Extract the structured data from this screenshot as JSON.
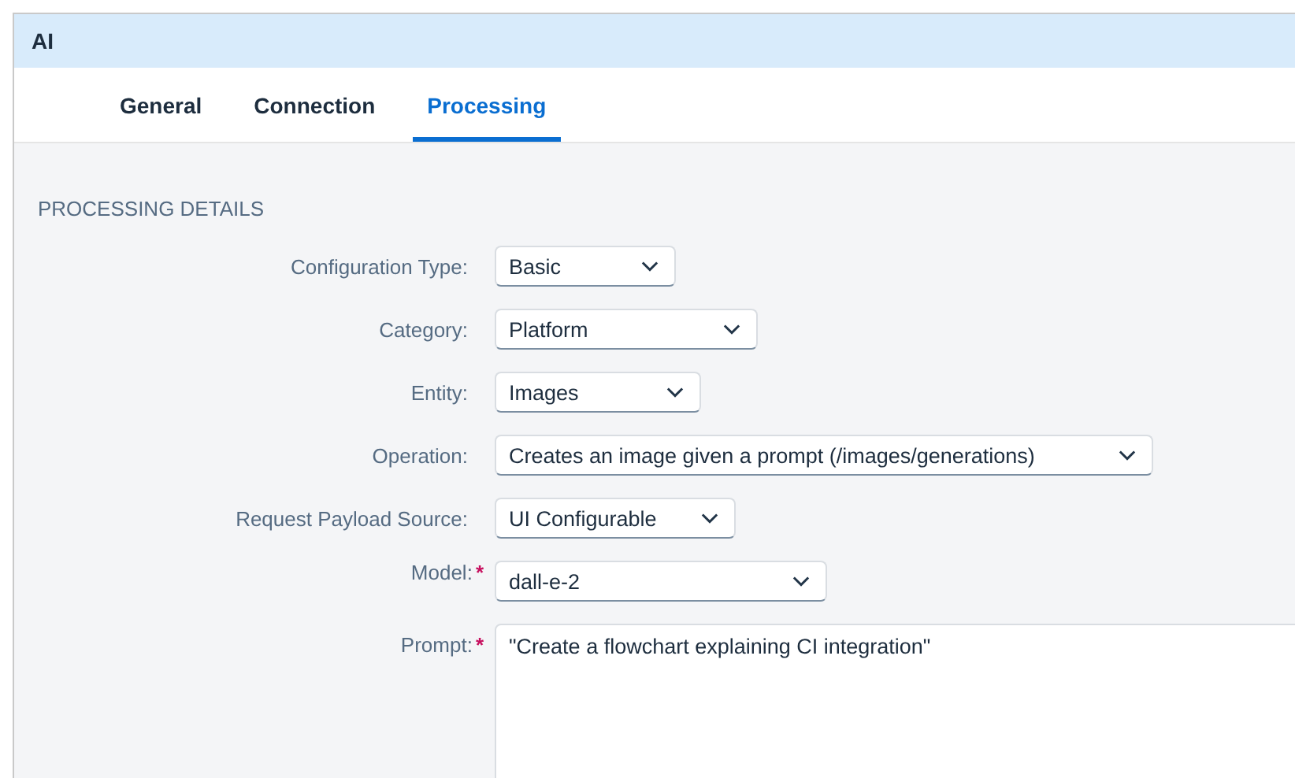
{
  "window": {
    "title": "AI"
  },
  "tabs": [
    {
      "label": "General",
      "selected": false
    },
    {
      "label": "Connection",
      "selected": false
    },
    {
      "label": "Processing",
      "selected": true
    }
  ],
  "section": {
    "title": "PROCESSING DETAILS"
  },
  "required_symbol": "*",
  "fields": [
    {
      "label": "Configuration Type:",
      "value": "Basic",
      "required": false,
      "kind": "select"
    },
    {
      "label": "Category:",
      "value": "Platform",
      "required": false,
      "kind": "select"
    },
    {
      "label": "Entity:",
      "value": "Images",
      "required": false,
      "kind": "select"
    },
    {
      "label": "Operation:",
      "value": "Creates an image given a prompt (/images/generations)",
      "required": false,
      "kind": "select"
    },
    {
      "label": "Request Payload Source:",
      "value": "UI Configurable",
      "required": false,
      "kind": "select"
    },
    {
      "label": "Model:",
      "value": "dall-e-2",
      "required": true,
      "kind": "select"
    },
    {
      "label": "Prompt:",
      "value": "\"Create a flowchart explaining CI integration\"",
      "required": true,
      "kind": "textarea"
    }
  ]
}
